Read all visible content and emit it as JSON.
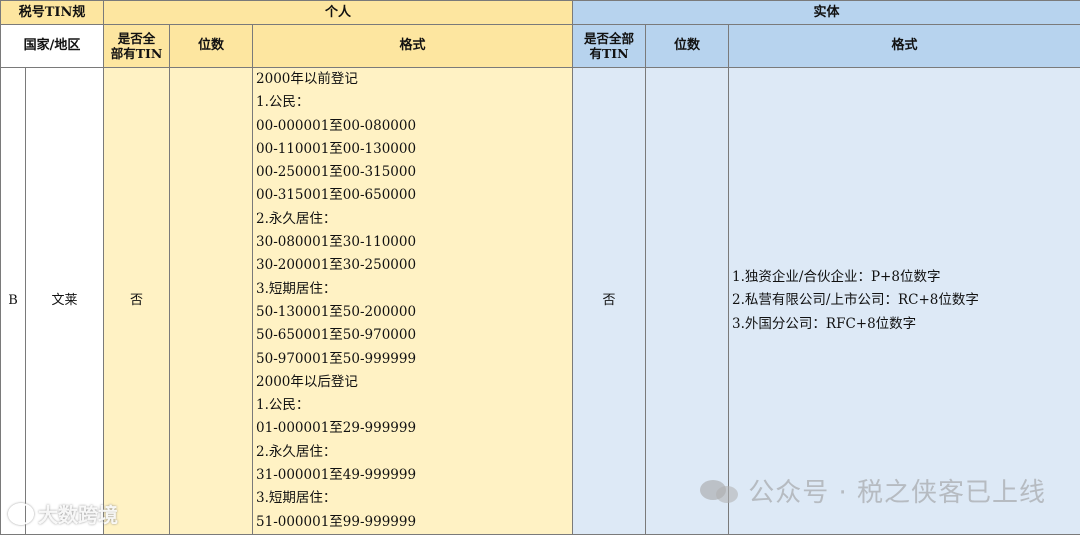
{
  "header": {
    "corner": "税号TIN规",
    "individual": "个人",
    "entity": "实体",
    "country": "国家/地区",
    "all_have_tin_1": "是否全",
    "all_have_tin_2": "部有TIN",
    "entity_all_have_tin_1": "是否全部",
    "entity_all_have_tin_2": "有TIN",
    "digits": "位数",
    "format": "格式"
  },
  "row": {
    "code": "B",
    "country": "文莱",
    "individual_all_have_tin": "否",
    "individual_digits": "",
    "individual_format": [
      "2000年以前登记",
      "1.公民：",
      "00-000001至00-080000",
      "00-110001至00-130000",
      "00-250001至00-315000",
      "00-315001至00-650000",
      "2.永久居住：",
      "30-080001至30-110000",
      "30-200001至30-250000",
      "3.短期居住：",
      "50-130001至50-200000",
      "50-650001至50-970000",
      "50-970001至50-999999",
      "2000年以后登记",
      "1.公民：",
      "01-000001至29-999999",
      "2.永久居住：",
      "31-000001至49-999999",
      "3.短期居住：",
      "51-000001至99-999999"
    ],
    "entity_all_have_tin": "否",
    "entity_digits": "",
    "entity_format": [
      "1.独资企业/合伙企业：P+8位数字",
      "2.私营有限公司/上市公司：RC+8位数字",
      "3.外国分公司：RFC+8位数字"
    ]
  },
  "watermark": {
    "account": "公众号 · 税之侠客已上线",
    "brand": "大数跨境"
  }
}
